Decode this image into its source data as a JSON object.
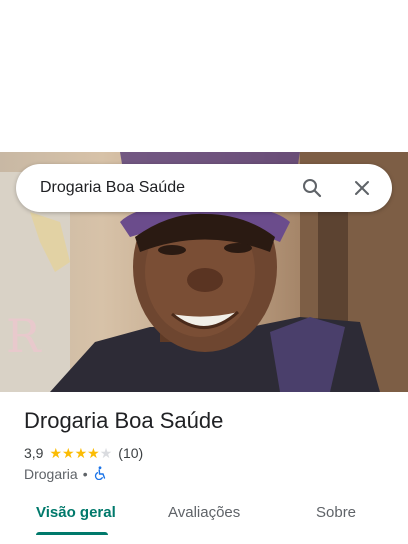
{
  "search": {
    "query": "Drogaria Boa Saúde"
  },
  "place": {
    "name": "Drogaria Boa Saúde",
    "rating": "3,9",
    "stars": {
      "value": 3.9,
      "max": 5
    },
    "review_count": "(10)",
    "category": "Drogaria",
    "separator": "•",
    "accessibility_icon": "wheelchair-icon"
  },
  "tabs": [
    {
      "label": "Visão geral",
      "active": true
    },
    {
      "label": "Avaliações",
      "active": false
    },
    {
      "label": "Sobre",
      "active": false
    }
  ],
  "colors": {
    "accent": "#00796b",
    "star": "#fbbc04",
    "accessibility": "#1a73e8"
  }
}
